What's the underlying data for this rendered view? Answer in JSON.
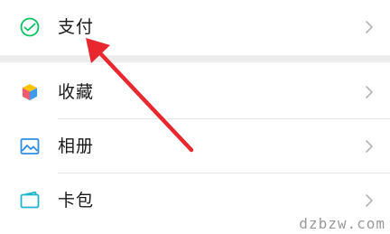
{
  "menu": {
    "pay": {
      "label": "支付",
      "icon": "wechat-pay-icon"
    },
    "favorites": {
      "label": "收藏",
      "icon": "cube-icon"
    },
    "album": {
      "label": "相册",
      "icon": "picture-icon"
    },
    "cards": {
      "label": "卡包",
      "icon": "card-wallet-icon"
    }
  },
  "colors": {
    "pay_green": "#07c160",
    "arrow_red": "#e8282e",
    "album_blue": "#2f8fe4",
    "cards_teal": "#1fb5c9"
  },
  "watermark": "dzbzw.com"
}
